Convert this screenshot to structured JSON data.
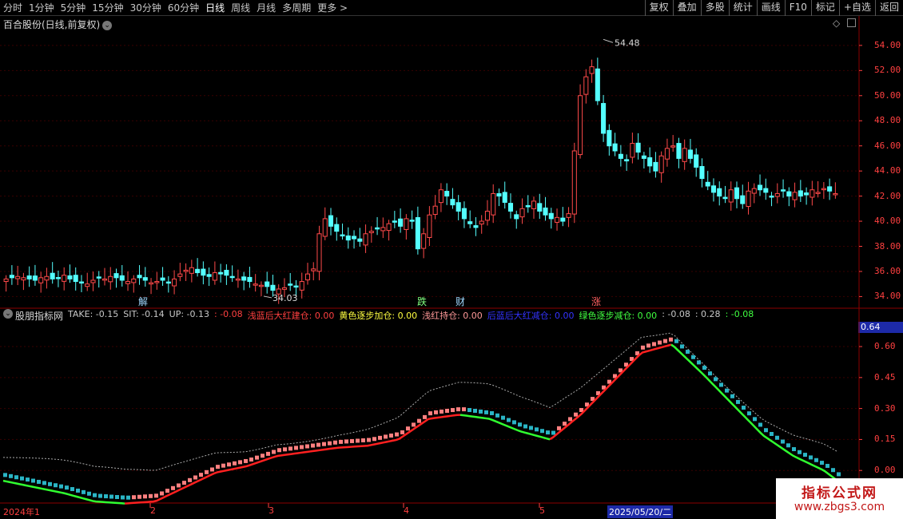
{
  "toolbar": {
    "periods": [
      "分时",
      "1分钟",
      "5分钟",
      "15分钟",
      "30分钟",
      "60分钟",
      "日线",
      "周线",
      "月线",
      "多周期",
      "更多 >"
    ],
    "active_period": "日线",
    "right_buttons": [
      "复权",
      "叠加",
      "多股",
      "统计",
      "画线",
      "F10",
      "标记",
      "+自选",
      "返回"
    ]
  },
  "main_chart": {
    "title": "百合股份(日线,前复权)",
    "high_label": "54.48",
    "low_label": "34.03",
    "price_axis": [
      "54.00",
      "52.00",
      "50.00",
      "48.00",
      "46.00",
      "44.00",
      "42.00",
      "40.00",
      "38.00",
      "36.00",
      "34.00"
    ],
    "markers": [
      {
        "text": "解",
        "color": "#9fd8ff"
      },
      {
        "text": "跌",
        "color": "#80ff80"
      },
      {
        "text": "财",
        "color": "#9fd8ff"
      },
      {
        "text": "涨",
        "color": "#ff6060"
      }
    ]
  },
  "indicator": {
    "name": "股朋指标网",
    "legend": [
      {
        "text": "TAKE: -0.15",
        "color": "#c8c8c8"
      },
      {
        "text": "SIT: -0.14",
        "color": "#c8c8c8"
      },
      {
        "text": "UP: -0.13",
        "color": "#c8c8c8"
      },
      {
        "text": ": -0.08",
        "color": "#ff4040"
      },
      {
        "text": "浅蓝后大红建仓: 0.00",
        "color": "#ff4040"
      },
      {
        "text": "黄色逐步加仓: 0.00",
        "color": "#ffff40"
      },
      {
        "text": "浅红持仓: 0.00",
        "color": "#ff9999"
      },
      {
        "text": "后蓝后大红减仓: 0.00",
        "color": "#3333ff"
      },
      {
        "text": "绿色逐步减仓: 0.00",
        "color": "#40ff40"
      },
      {
        "text": ": -0.08",
        "color": "#c8c8c8"
      },
      {
        "text": ": 0.28",
        "color": "#c8c8c8"
      },
      {
        "text": ": -0.08",
        "color": "#40ff40"
      }
    ],
    "value_axis": [
      "0.60",
      "0.45",
      "0.30",
      "0.15",
      "0.00"
    ],
    "current_value": "0.64"
  },
  "date_axis": [
    "2024年1",
    "2",
    "3",
    "4",
    "5",
    "2025/05/20/二"
  ],
  "logo": {
    "line1": "指标公式网",
    "line2": "www.zbgs3.com"
  },
  "chart_data": {
    "type": "candlestick",
    "title": "百合股份(日线,前复权)",
    "price_range": [
      33.2,
      55.2
    ],
    "annotated_high": 54.48,
    "annotated_low": 34.03,
    "close_series_approx": [
      35.4,
      35.5,
      35.6,
      35.5,
      35.4,
      35.3,
      35.5,
      35.6,
      35.4,
      35.5,
      35.7,
      35.4,
      35.2,
      35.1,
      35.0,
      35.3,
      35.5,
      35.4,
      35.6,
      35.5,
      35.3,
      35.2,
      35.4,
      35.5,
      35.3,
      35.1,
      35.2,
      35.3,
      35.1,
      35.4,
      35.8,
      36.1,
      36.3,
      35.9,
      35.7,
      35.6,
      35.9,
      35.8,
      35.7,
      35.6,
      35.4,
      35.3,
      35.2,
      35.0,
      34.9,
      34.8,
      34.5,
      34.6,
      34.7,
      34.9,
      34.8,
      35.2,
      35.8,
      36.2,
      39.0,
      40.2,
      39.6,
      39.2,
      38.9,
      38.5,
      38.6,
      38.4,
      39.0,
      39.2,
      39.4,
      39.5,
      39.8,
      40.0,
      39.6,
      40.2,
      40.0,
      37.8,
      39.0,
      40.5,
      41.2,
      42.5,
      42.0,
      41.3,
      40.8,
      40.2,
      39.8,
      39.5,
      40.0,
      40.8,
      42.2,
      42.0,
      41.5,
      40.8,
      40.2,
      41.0,
      41.2,
      41.6,
      40.8,
      40.5,
      40.2,
      40.3,
      40.0,
      40.6,
      45.6,
      50.0,
      51.5,
      52.3,
      49.6,
      47.0,
      46.0,
      45.6,
      45.0,
      44.8,
      46.2,
      45.5,
      45.0,
      44.4,
      44.0,
      45.2,
      45.8,
      46.0,
      45.0,
      45.8,
      45.0,
      44.3,
      43.4,
      42.8,
      42.3,
      42.0,
      41.8,
      42.5,
      41.8,
      41.4,
      42.4,
      42.6,
      42.5,
      42.3,
      42.0,
      42.2,
      42.4,
      42.0,
      42.3,
      42.0,
      42.1,
      42.5,
      42.3,
      42.6,
      42.4,
      42.2
    ],
    "indicator_range": [
      -0.15,
      0.72
    ],
    "indicator_series_approx": {
      "name": "股朋指标网",
      "values": [
        -0.02,
        -0.05,
        -0.08,
        -0.12,
        -0.13,
        -0.12,
        -0.05,
        0.02,
        0.05,
        0.1,
        0.12,
        0.14,
        0.15,
        0.18,
        0.28,
        0.3,
        0.28,
        0.22,
        0.18,
        0.3,
        0.45,
        0.6,
        0.64,
        0.5,
        0.35,
        0.2,
        0.1,
        0.03,
        -0.08
      ]
    }
  }
}
